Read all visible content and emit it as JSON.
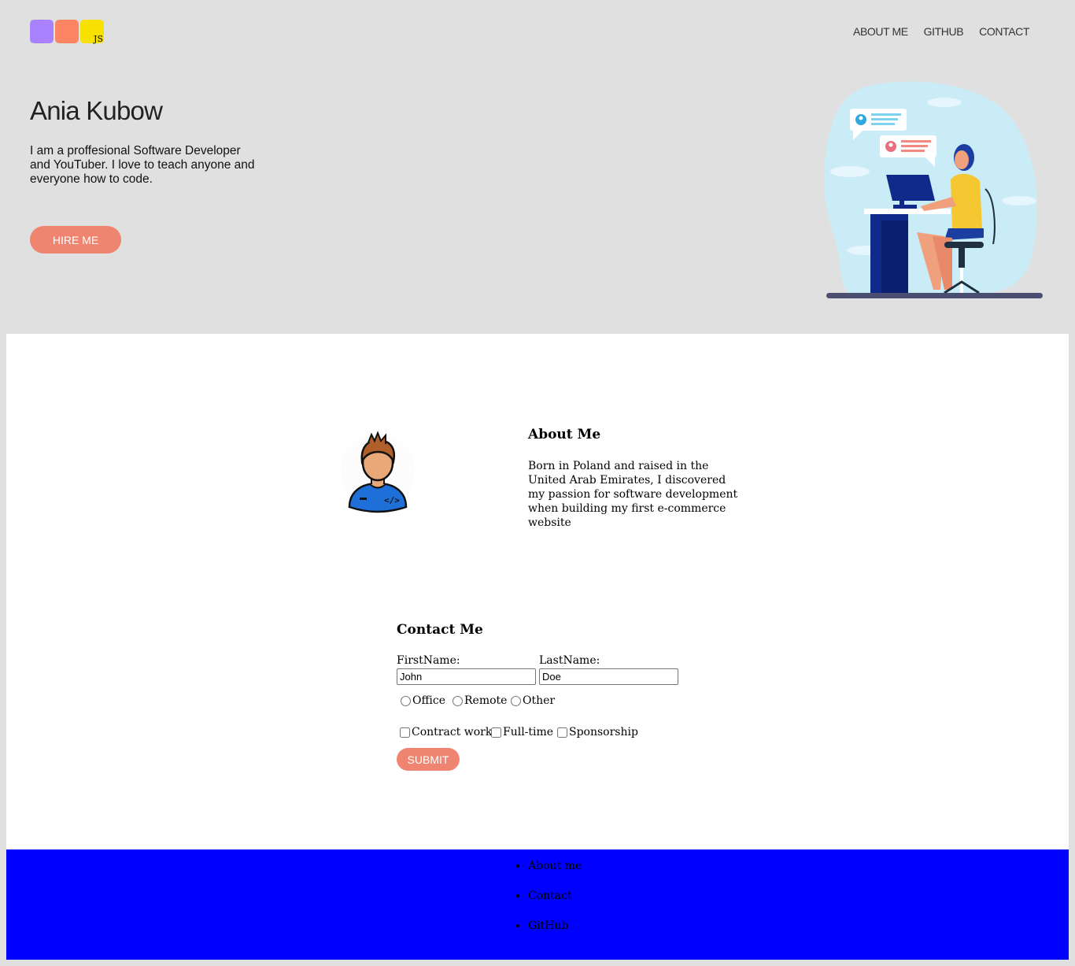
{
  "logo": {
    "badge_text": "JS"
  },
  "nav": {
    "items": [
      {
        "label": "ABOUT ME"
      },
      {
        "label": "GITHUB"
      },
      {
        "label": "CONTACT"
      }
    ]
  },
  "hero": {
    "title": "Ania Kubow",
    "description": "I am a proffesional Software Developer and YouTuber. I love to teach anyone and everyone how to code.",
    "button_label": "HIRE ME"
  },
  "about": {
    "title": "About Me",
    "text": "Born in Poland and raised in the United Arab Emirates, I discovered my passion for software development when building my first e-commerce website"
  },
  "contact": {
    "title": "Contact Me",
    "first_name_label": "FirstName:",
    "first_name_value": "John",
    "last_name_label": "LastName:",
    "last_name_value": "Doe",
    "work_location_options": [
      "Office",
      "Remote",
      "Other"
    ],
    "job_type_options": [
      "Contract work",
      "Full-time",
      "Sponsorship"
    ],
    "submit_label": "SUBMIT"
  },
  "footer": {
    "links": [
      "About me",
      "Contact",
      "GitHub"
    ]
  },
  "colors": {
    "background": "#e0e0e0",
    "accent": "#ef8470",
    "footer": "#0000ff",
    "logo_purple": "#a982ff",
    "logo_orange": "#fd8563",
    "logo_yellow": "#f6e100"
  }
}
